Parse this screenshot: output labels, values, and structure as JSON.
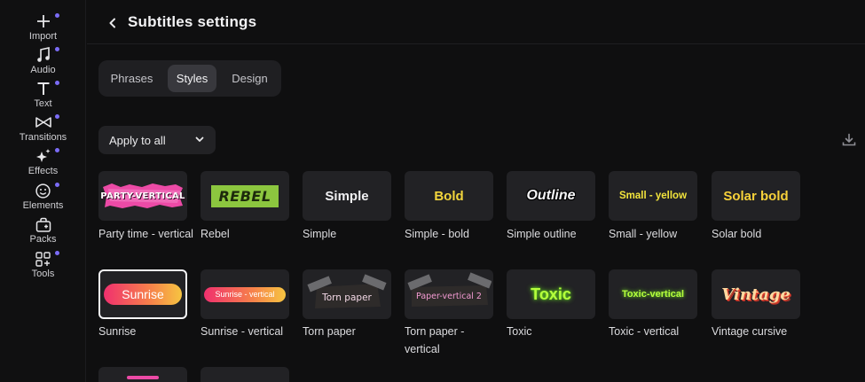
{
  "sidebar": {
    "items": [
      {
        "label": "Import",
        "icon": "plus-icon",
        "dot": true
      },
      {
        "label": "Audio",
        "icon": "music-note-icon",
        "dot": true
      },
      {
        "label": "Text",
        "icon": "text-icon",
        "dot": true
      },
      {
        "label": "Transitions",
        "icon": "bowtie-icon",
        "dot": true
      },
      {
        "label": "Effects",
        "icon": "sparkle-icon",
        "dot": true
      },
      {
        "label": "Elements",
        "icon": "smiley-icon",
        "dot": true
      },
      {
        "label": "Packs",
        "icon": "bag-icon",
        "dot": false
      },
      {
        "label": "Tools",
        "icon": "grid-icon",
        "dot": true
      }
    ],
    "dot_color": "#7b6cf6"
  },
  "header": {
    "title": "Subtitles settings"
  },
  "tabs": [
    {
      "label": "Phrases",
      "active": false
    },
    {
      "label": "Styles",
      "active": true
    },
    {
      "label": "Design",
      "active": false
    }
  ],
  "apply_dropdown": {
    "value": "Apply to all"
  },
  "styles": [
    {
      "label": "Party time - vertical",
      "preview": "PARTY-VERTICAL"
    },
    {
      "label": "Rebel",
      "preview": "REBEL"
    },
    {
      "label": "Simple",
      "preview": "Simple"
    },
    {
      "label": "Simple - bold",
      "preview": "Bold"
    },
    {
      "label": "Simple outline",
      "preview": "Outline"
    },
    {
      "label": "Small - yellow",
      "preview": "Small - yellow"
    },
    {
      "label": "Solar bold",
      "preview": "Solar bold"
    },
    {
      "label": "Sunrise",
      "preview": "Sunrise",
      "selected": true
    },
    {
      "label": "Sunrise - vertical",
      "preview": "Sunrise - vertical"
    },
    {
      "label": "Torn paper",
      "preview": "Torn paper"
    },
    {
      "label": "Torn paper - vertical",
      "preview": "Paper-vertical 2"
    },
    {
      "label": "Toxic",
      "preview": "Toxic"
    },
    {
      "label": "Toxic - vertical",
      "preview": "Toxic-vertical"
    },
    {
      "label": "Vintage cursive",
      "preview": "Vintage"
    }
  ],
  "colors": {
    "background": "#0f0f10",
    "card": "#222225",
    "accent_dot": "#7b6cf6",
    "yellow": "#f2d53c",
    "toxic_green": "#b6ff3c",
    "pink": "#ec4aa6"
  }
}
